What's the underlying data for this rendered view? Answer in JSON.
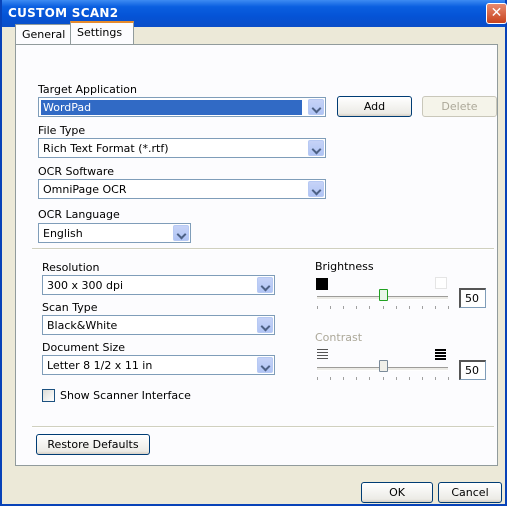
{
  "window": {
    "title": "CUSTOM SCAN2",
    "close_label": "✕"
  },
  "tabs": [
    {
      "label": "General"
    },
    {
      "label": "Settings"
    }
  ],
  "settings": {
    "target_application": {
      "label": "Target Application",
      "value": "WordPad",
      "add_label": "Add",
      "delete_label": "Delete"
    },
    "file_type": {
      "label": "File Type",
      "value": "Rich Text Format (*.rtf)"
    },
    "ocr_software": {
      "label": "OCR Software",
      "value": "OmniPage OCR"
    },
    "ocr_language": {
      "label": "OCR Language",
      "value": "English"
    },
    "resolution": {
      "label": "Resolution",
      "value": "300 x 300 dpi"
    },
    "scan_type": {
      "label": "Scan Type",
      "value": "Black&White"
    },
    "document_size": {
      "label": "Document Size",
      "value": "Letter 8 1/2 x 11 in"
    },
    "show_scanner_interface": {
      "label": "Show Scanner Interface",
      "checked": false
    },
    "brightness": {
      "label": "Brightness",
      "value": "50",
      "level": 50
    },
    "contrast": {
      "label": "Contrast",
      "value": "50",
      "level": 50,
      "enabled": false
    },
    "restore_defaults_label": "Restore Defaults"
  },
  "footer": {
    "ok_label": "OK",
    "cancel_label": "Cancel"
  },
  "colors": {
    "titlebar": "#0553d6",
    "active_tab_accent": "#e68b2c",
    "selection": "#316ac5",
    "dialog_bg": "#ece9d8"
  }
}
